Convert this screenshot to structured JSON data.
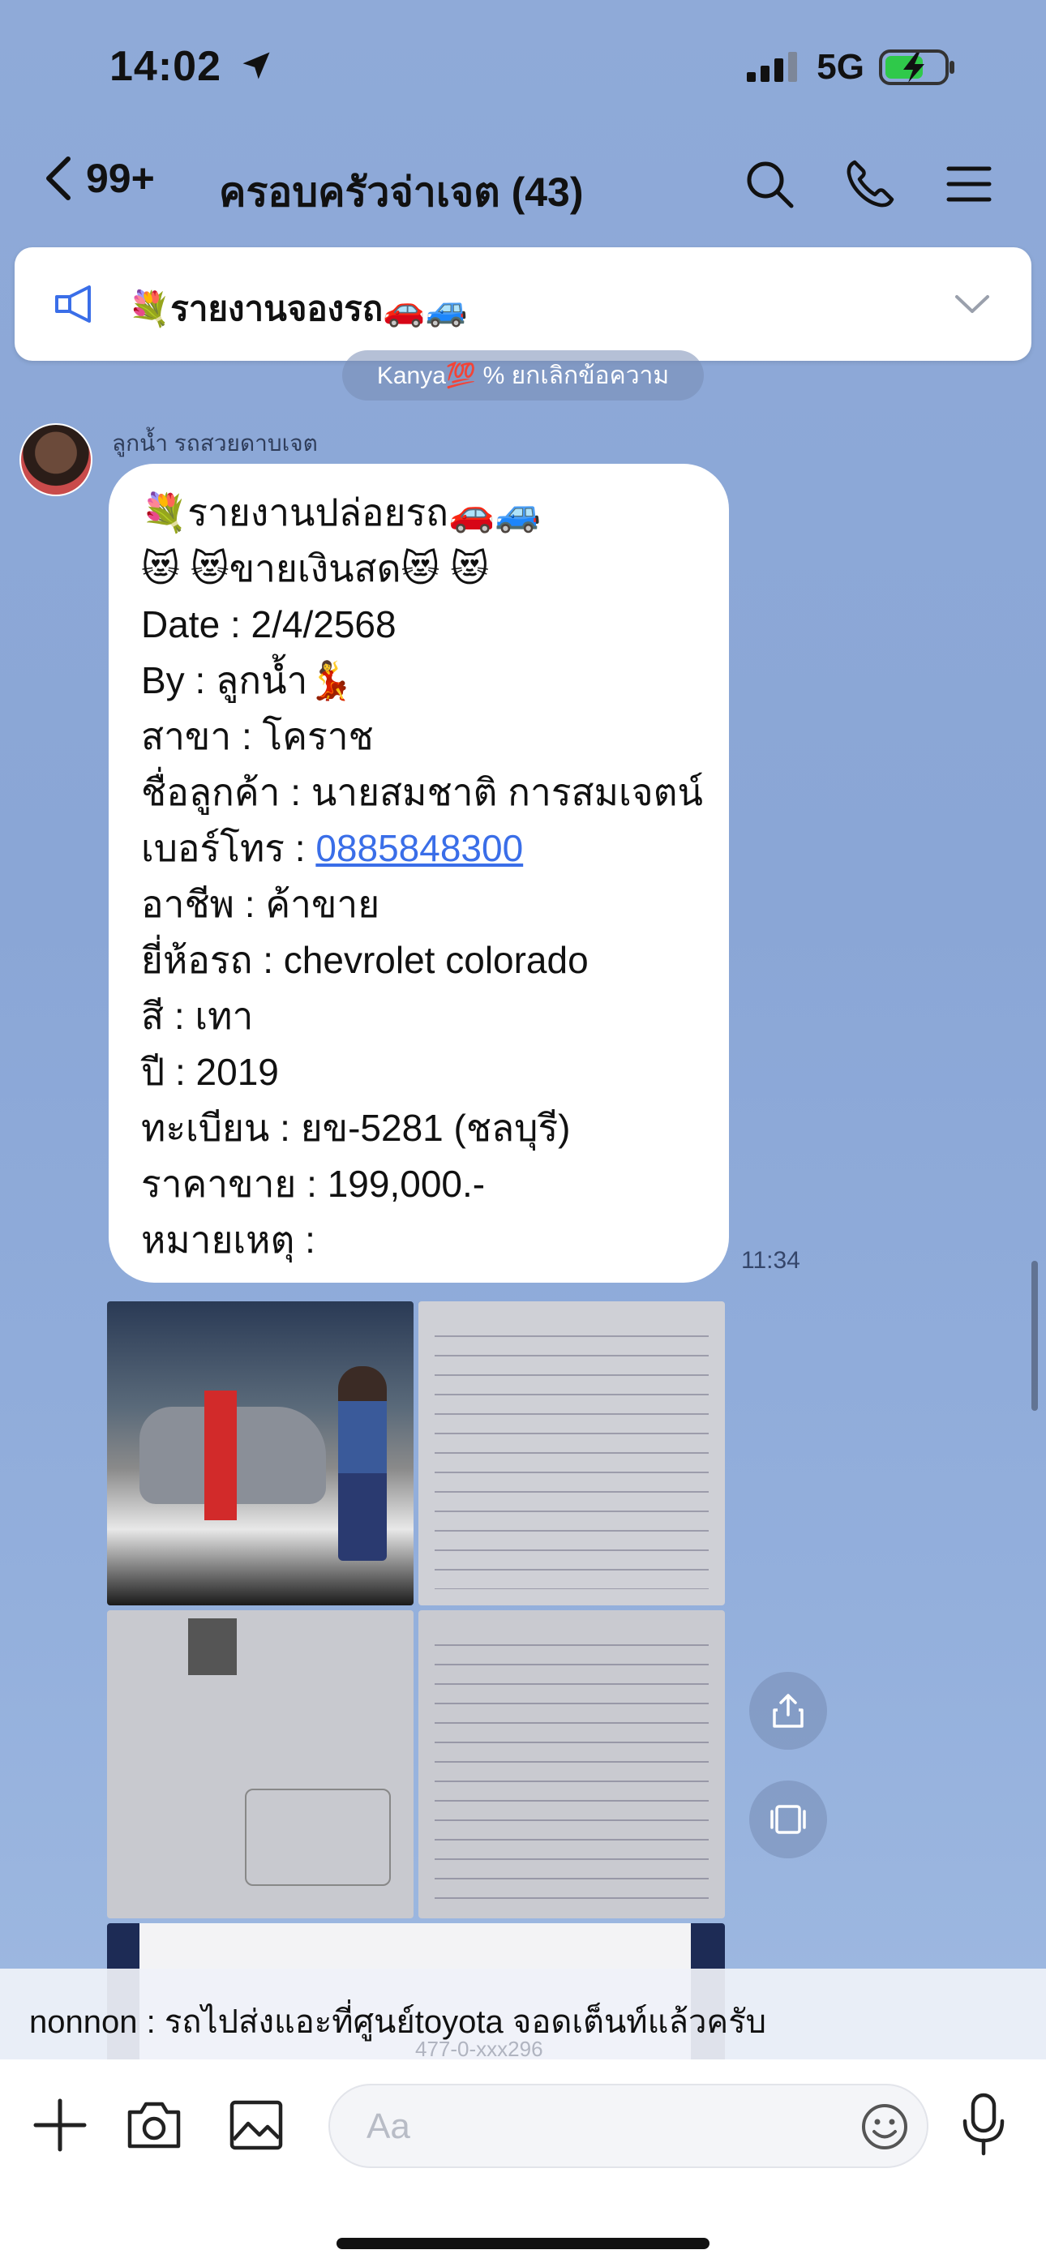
{
  "status": {
    "time": "14:02",
    "network": "5G"
  },
  "header": {
    "back_count": "99+",
    "title": "ครอบครัวจ่าเจต (43)"
  },
  "announcement": {
    "text": "💐รายงานจองรถ🚗🚙"
  },
  "unsend_notice": "Kanya💯 % ยกเลิกข้อความ",
  "message": {
    "sender": "ลูกน้ำ รถสวยดาบเจต",
    "time": "11:34",
    "lines": [
      " 💐รายงานปล่อยรถ🚗🚙",
      "😻 😻ขายเงินสด😻 😻",
      "Date : 2/4/2568",
      "By : ลูกน้ำ💃",
      "สาขา : โคราช",
      "ชื่อลูกค้า : นายสมชาติ การสมเจตน์",
      "เบอร์โทร : ",
      "อาชีพ : ค้าขาย",
      "ยี่ห้อรถ : chevrolet colorado",
      "สี : เทา",
      "ปี : 2019",
      "ทะเบียน : ยข-5281 (ชลบุรี)",
      "ราคาขาย : 199,000.-",
      "หมายเหตุ :"
    ],
    "phone": "0885848300"
  },
  "preview": {
    "text": "nonnon : รถไปส่งแอะที่ศูนย์toyota จอดเต็นท์แล้วครับ",
    "faded": "477-0-xxx296"
  },
  "input": {
    "placeholder": "Aa"
  },
  "icons": {
    "navigation": "location-arrow-icon",
    "signal": "signal-icon",
    "battery": "battery-charging-icon",
    "back": "chevron-left-icon",
    "search": "search-icon",
    "call": "phone-icon",
    "menu": "hamburger-menu-icon",
    "announce": "megaphone-icon",
    "expand": "chevron-down-icon",
    "share": "share-icon",
    "gallery": "album-icon",
    "add": "plus-icon",
    "camera": "camera-icon",
    "image": "image-icon",
    "emoji": "emoji-icon",
    "mic": "microphone-icon"
  },
  "colors": {
    "background": "#8faad8",
    "link": "#3a6ee8",
    "announce_icon": "#3a6ee8"
  }
}
